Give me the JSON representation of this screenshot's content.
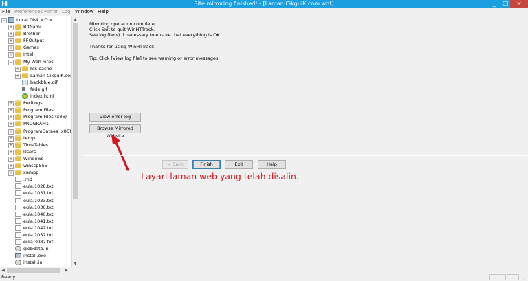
{
  "app": {
    "icon_letter": "H",
    "title": "Site mirroring finished! - [Laman CikgulK.com.wht]",
    "window_buttons": {
      "minimize": "_",
      "maximize": "□",
      "close": "×"
    }
  },
  "menu": [
    {
      "label": "File",
      "enabled": true
    },
    {
      "label": "Preferences",
      "enabled": false
    },
    {
      "label": "Mirror",
      "enabled": false
    },
    {
      "label": "Log",
      "enabled": false
    },
    {
      "label": "Window",
      "enabled": true
    },
    {
      "label": "Help",
      "enabled": true
    }
  ],
  "tree": {
    "root": "Local Disk <C:>",
    "items": [
      {
        "label": "BitNami",
        "type": "folder",
        "expander": "+"
      },
      {
        "label": "Brother",
        "type": "folder",
        "expander": "+"
      },
      {
        "label": "FFOutput",
        "type": "folder",
        "expander": "+"
      },
      {
        "label": "Games",
        "type": "folder",
        "expander": "+"
      },
      {
        "label": "Intel",
        "type": "folder",
        "expander": "+"
      },
      {
        "label": "My Web Sites",
        "type": "folder",
        "expander": "−"
      },
      {
        "label": "hts-cache",
        "type": "folder",
        "expander": "+"
      },
      {
        "label": "Laman CikgulK.com",
        "type": "folder",
        "expander": "+"
      },
      {
        "label": "backblue.gif",
        "type": "gif",
        "expander": ""
      },
      {
        "label": "fade.gif",
        "type": "fade",
        "expander": ""
      },
      {
        "label": "index.html",
        "type": "html",
        "expander": ""
      },
      {
        "label": "PerfLogs",
        "type": "folder",
        "expander": "+"
      },
      {
        "label": "Program Files",
        "type": "folder",
        "expander": "+"
      },
      {
        "label": "Program Files (x86)",
        "type": "folder",
        "expander": "+"
      },
      {
        "label": "PROGRAM1",
        "type": "folder",
        "expander": "+"
      },
      {
        "label": "ProgramDataes (x86)",
        "type": "folder",
        "expander": "+"
      },
      {
        "label": "temp",
        "type": "folder",
        "expander": "+"
      },
      {
        "label": "TimeTables",
        "type": "folder",
        "expander": "+"
      },
      {
        "label": "Users",
        "type": "folder",
        "expander": "+"
      },
      {
        "label": "Windows",
        "type": "folder",
        "expander": "+"
      },
      {
        "label": "winscp555",
        "type": "folder",
        "expander": "+"
      },
      {
        "label": "xampp",
        "type": "folder",
        "expander": "+"
      },
      {
        "label": ".rnd",
        "type": "file",
        "expander": ""
      },
      {
        "label": "eula.1028.txt",
        "type": "file",
        "expander": ""
      },
      {
        "label": "eula.1031.txt",
        "type": "file",
        "expander": ""
      },
      {
        "label": "eula.1033.txt",
        "type": "file",
        "expander": ""
      },
      {
        "label": "eula.1036.txt",
        "type": "file",
        "expander": ""
      },
      {
        "label": "eula.1040.txt",
        "type": "file",
        "expander": ""
      },
      {
        "label": "eula.1041.txt",
        "type": "file",
        "expander": ""
      },
      {
        "label": "eula.1042.txt",
        "type": "file",
        "expander": ""
      },
      {
        "label": "eula.2052.txt",
        "type": "file",
        "expander": ""
      },
      {
        "label": "eula.3082.txt",
        "type": "file",
        "expander": ""
      },
      {
        "label": "globdata.ini",
        "type": "ini",
        "expander": ""
      },
      {
        "label": "install.exe",
        "type": "exe",
        "expander": ""
      },
      {
        "label": "install.ini",
        "type": "ini",
        "expander": ""
      }
    ]
  },
  "messages": {
    "line1": "Mirroring operation complete.",
    "line2": "Click Exit to quit WinHTTrack.",
    "line3": "See log file(s) if necessary to ensure that everything is OK.",
    "line4": "Thanks for using WinHTTrack!",
    "line5": "Tip: Click [View log file] to see warning or error messages"
  },
  "buttons": {
    "view_error_log": "View error log",
    "browse_mirrored": "Browse Mirrored Website",
    "back": "< Back",
    "finish": "Finish",
    "exit": "Exit",
    "help": "Help"
  },
  "annotation": {
    "text": "Layari laman web yang telah disalin.",
    "color": "#d4141d"
  },
  "status": {
    "text": "Ready"
  },
  "colors": {
    "titlebar": "#1b9fe0",
    "close_button": "#c7463f"
  }
}
